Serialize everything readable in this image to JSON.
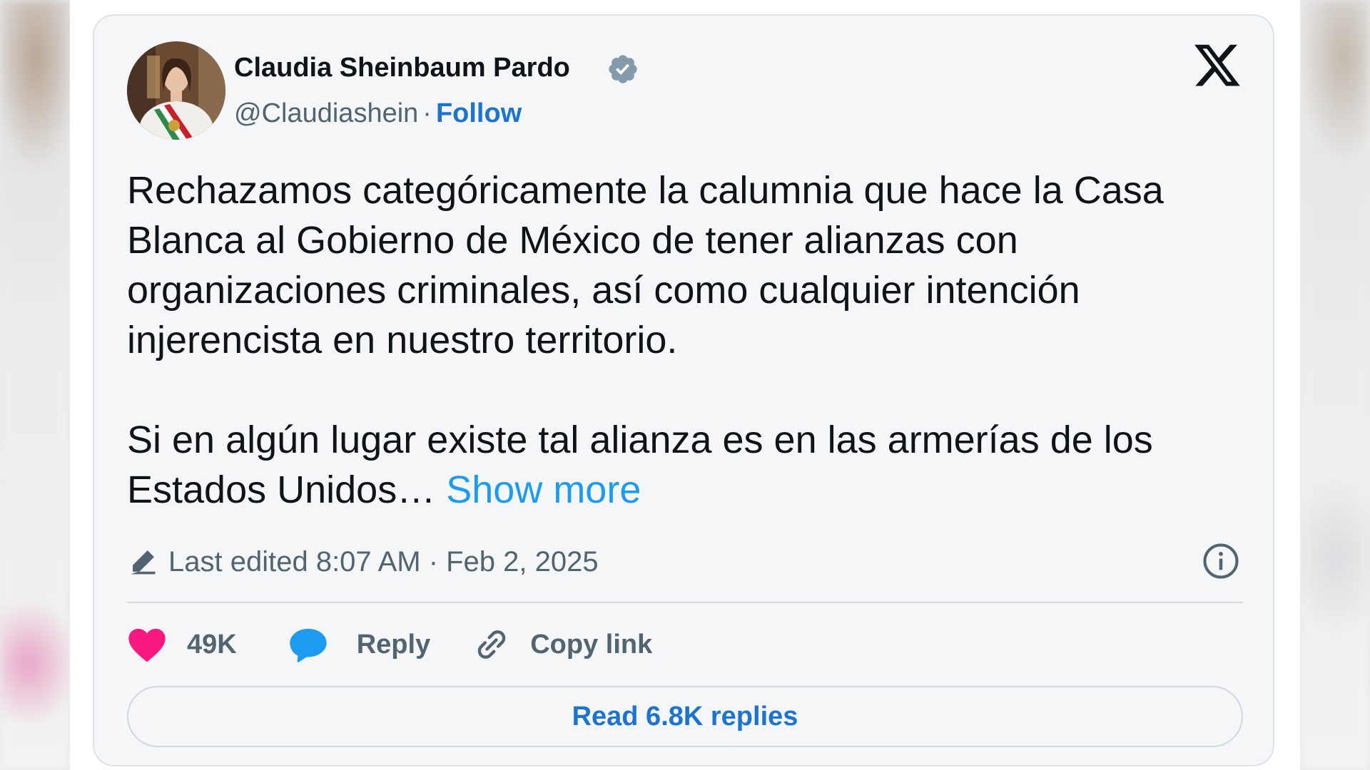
{
  "author": {
    "name": "Claudia Sheinbaum Pardo",
    "handle": "@Claudiashein",
    "separator": "·",
    "follow_label": "Follow",
    "verified": true
  },
  "tweet": {
    "paragraph1": "Rechazamos categóricamente la calumnia que hace la Casa Blanca al Gobierno de México de tener alianzas con organizaciones criminales, así como cualquier intención injerencista en nuestro territorio.",
    "paragraph2": "Si en algún lugar existe tal alianza es en las armerías de los Estados Unidos…",
    "show_more": "Show more",
    "edited": "Last edited 8:07 AM · Feb 2, 2025"
  },
  "actions": {
    "likes": "49K",
    "reply_label": "Reply",
    "copy_label": "Copy link"
  },
  "replies_button": "Read 6.8K replies",
  "icons": {
    "brand": "x-logo-icon",
    "verified": "verified-badge-icon",
    "edit": "pencil-icon",
    "info": "info-icon",
    "like": "heart-icon",
    "reply": "speech-bubble-icon",
    "copy": "link-icon"
  },
  "colors": {
    "like": "#f91880",
    "reply": "#1d9bf0",
    "follow": "#1d74d0",
    "verified": "#829aab"
  }
}
